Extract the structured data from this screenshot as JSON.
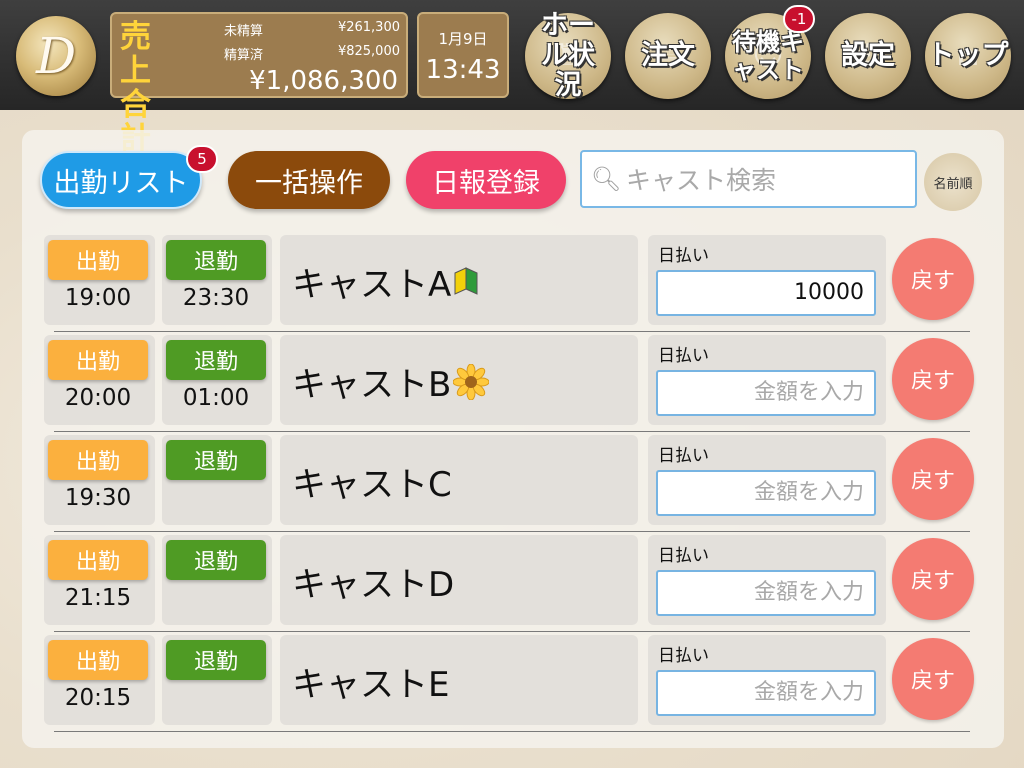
{
  "header": {
    "logo_letter": "D",
    "sales": {
      "title": "売上合計",
      "unsettled_label": "未精算",
      "unsettled_value": "¥261,300",
      "settled_label": "精算済",
      "settled_value": "¥825,000",
      "total": "¥1,086,300"
    },
    "date": "1月9日",
    "time": "13:43",
    "nav": [
      {
        "label": "ホール状況",
        "icon": "hall-icon"
      },
      {
        "label": "注文",
        "icon": "order-icon"
      },
      {
        "label": "待機キャスト",
        "icon": "cast-icon",
        "badge": "-1"
      },
      {
        "label": "設定",
        "icon": "settings-icon"
      },
      {
        "label": "トップ",
        "icon": "home-icon"
      }
    ]
  },
  "toolbar": {
    "attendance_list": "出勤リスト",
    "attendance_badge": "5",
    "bulk_operation": "一括操作",
    "daily_report": "日報登録",
    "search_placeholder": "キャスト検索",
    "sort": "名前順"
  },
  "rows": [
    {
      "clock_in": "出勤",
      "clock_out": "退勤",
      "in_time": "19:00",
      "out_time": "23:30",
      "name": "キャストA",
      "mark": "beginner-mark",
      "pay_label": "日払い",
      "pay_value": "10000",
      "pay_placeholder": "金額を入力",
      "back": "戻す"
    },
    {
      "clock_in": "出勤",
      "clock_out": "退勤",
      "in_time": "20:00",
      "out_time": "01:00",
      "name": "キャストB",
      "mark": "flower-mark",
      "pay_label": "日払い",
      "pay_value": "",
      "pay_placeholder": "金額を入力",
      "back": "戻す"
    },
    {
      "clock_in": "出勤",
      "clock_out": "退勤",
      "in_time": "19:30",
      "out_time": "",
      "name": "キャストC",
      "mark": "",
      "pay_label": "日払い",
      "pay_value": "",
      "pay_placeholder": "金額を入力",
      "back": "戻す"
    },
    {
      "clock_in": "出勤",
      "clock_out": "退勤",
      "in_time": "21:15",
      "out_time": "",
      "name": "キャストD",
      "mark": "",
      "pay_label": "日払い",
      "pay_value": "",
      "pay_placeholder": "金額を入力",
      "back": "戻す"
    },
    {
      "clock_in": "出勤",
      "clock_out": "退勤",
      "in_time": "20:15",
      "out_time": "",
      "name": "キャストE",
      "mark": "",
      "pay_label": "日払い",
      "pay_value": "",
      "pay_placeholder": "金額を入力",
      "back": "戻す"
    }
  ],
  "colors": {
    "clock_in": "#fbb03e",
    "clock_out": "#4f9b24",
    "attendance_list": "#1f9be6",
    "bulk_operation": "#8b4a0c",
    "daily_report": "#f0416a",
    "back": "#f47b72",
    "badge": "#c8102e"
  }
}
